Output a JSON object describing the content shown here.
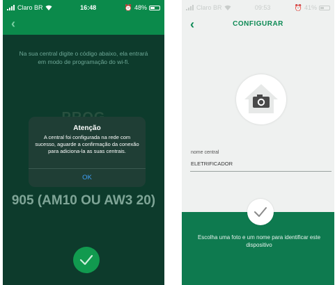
{
  "colors": {
    "brand_green": "#0b8a4b",
    "dark_bg": "#0d3b2c",
    "bottom_panel": "#0e7a4f",
    "alert_button": "#3f9ff5"
  },
  "left": {
    "status": {
      "carrier": "Claro BR",
      "time": "16:48",
      "battery": "48%"
    },
    "back_icon": "chevron-left-icon",
    "instructions": "Na sua central digite o código abaixo, ela entrará em modo de programação do wi-fi.",
    "code_top": "PROG",
    "code": "905 (AM10 OU AW3 20)",
    "alert": {
      "title": "Atenção",
      "message": "A central foi configurada na rede com sucesso, aguarde a confirmação da conexão para adiciona-la as suas centrais.",
      "button": "OK"
    },
    "confirm_icon": "check-icon"
  },
  "right": {
    "status": {
      "carrier": "Claro BR",
      "time": "09:53",
      "battery": "41%"
    },
    "back_icon": "chevron-left-icon",
    "title": "CONFIGURAR",
    "photo_icon": "house-camera-icon",
    "field": {
      "label": "nome central",
      "value": "ELETRIFICADOR"
    },
    "confirm_icon": "check-icon",
    "hint": "Escolha uma foto e um nome para identificar este dispositivo"
  }
}
